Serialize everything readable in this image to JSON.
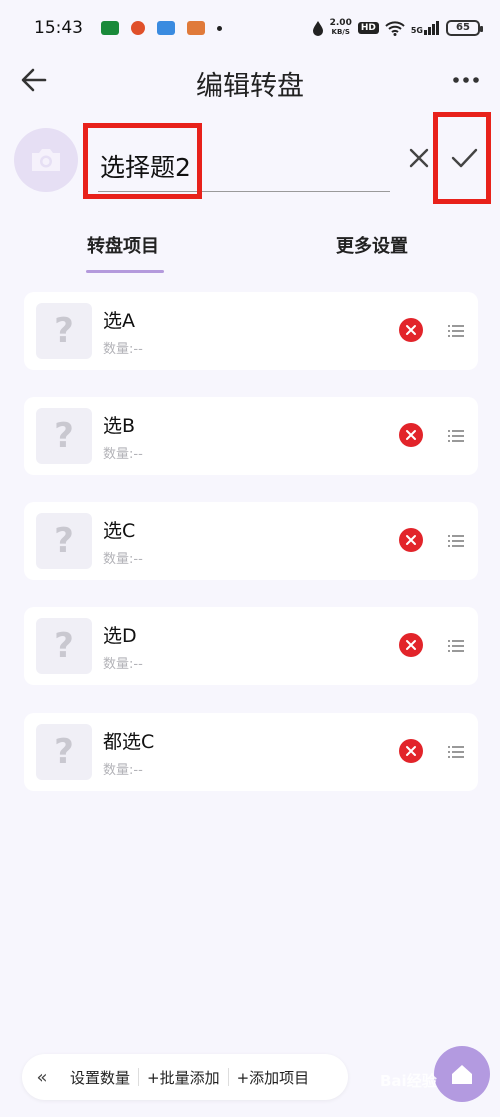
{
  "status_bar": {
    "time": "15:43",
    "net_speed_value": "2.00",
    "net_speed_unit": "KB/S",
    "hd_label": "HD",
    "signal_label": "5G",
    "battery": "65"
  },
  "header": {
    "title": "编辑转盘",
    "back_icon": "arrow-left-icon",
    "more_icon": "more-dots-icon"
  },
  "editor": {
    "name_value": "选择题2",
    "avatar_icon": "camera-icon",
    "clear_icon": "close-icon",
    "confirm_icon": "check-icon"
  },
  "tabs": [
    {
      "label": "转盘项目",
      "active": true
    },
    {
      "label": "更多设置",
      "active": false
    }
  ],
  "items": [
    {
      "label": "选A",
      "qty": "数量:--",
      "thumb": "?"
    },
    {
      "label": "选B",
      "qty": "数量:--",
      "thumb": "?"
    },
    {
      "label": "选C",
      "qty": "数量:--",
      "thumb": "?"
    },
    {
      "label": "选D",
      "qty": "数量:--",
      "thumb": "?"
    },
    {
      "label": "都选C",
      "qty": "数量:--",
      "thumb": "?"
    }
  ],
  "bottom_bar": {
    "collapse": "«",
    "set_quantity": "设置数量",
    "batch_add": "+批量添加",
    "add_item": "+添加项目"
  },
  "watermark": "Bai经验",
  "colors": {
    "accent": "#b49adc",
    "highlight_box": "#e8211b",
    "delete": "#e2242a",
    "background": "#f7f6fd"
  }
}
